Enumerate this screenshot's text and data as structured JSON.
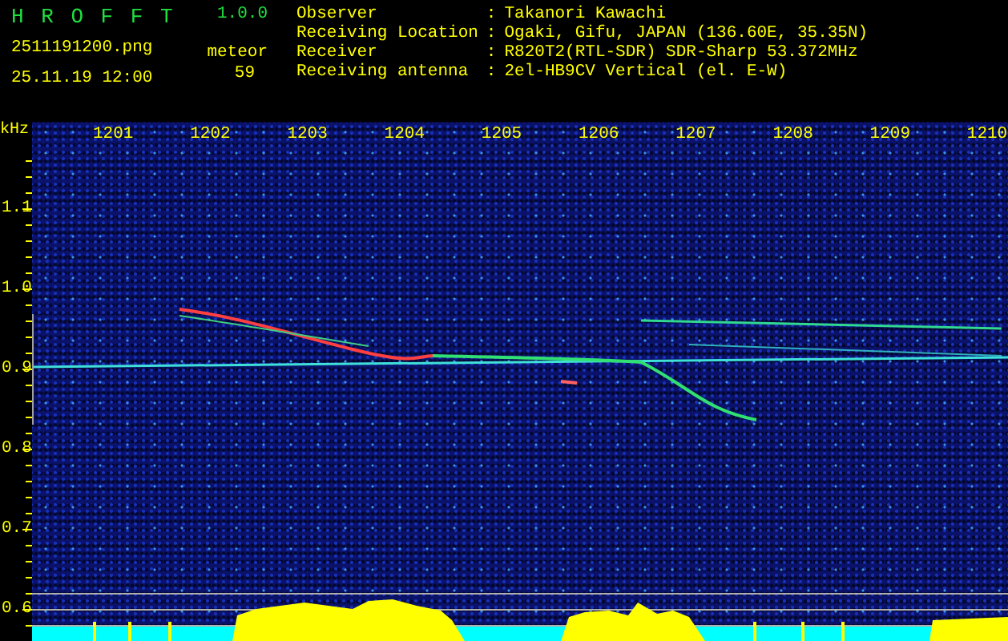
{
  "app": {
    "title": "H R O F F T",
    "version": "1.0.0",
    "filename": "2511191200.png",
    "datetime": "25.11.19 12:00",
    "meteor_label": "meteor",
    "meteor_count": "59"
  },
  "station": [
    {
      "label": "Observer",
      "separator": ":",
      "value": "Takanori Kawachi"
    },
    {
      "label": "Receiving Location",
      "separator": ":",
      "value": "Ogaki, Gifu, JAPAN (136.60E, 35.35N)"
    },
    {
      "label": "Receiver",
      "separator": ":",
      "value": "R820T2(RTL-SDR) SDR-Sharp 53.372MHz"
    },
    {
      "label": "Receiving antenna",
      "separator": ":",
      "value": "2el-HB9CV Vertical (el. E-W)"
    }
  ],
  "spectrogram": {
    "y_unit": "kHz",
    "x_labels": [
      "1201",
      "1202",
      "1203",
      "1204",
      "1205",
      "1206",
      "1207",
      "1208",
      "1209",
      "1210"
    ],
    "y_labels": [
      "1.1",
      "1.0",
      "0.9",
      "0.8",
      "0.7",
      "0.6"
    ]
  }
}
